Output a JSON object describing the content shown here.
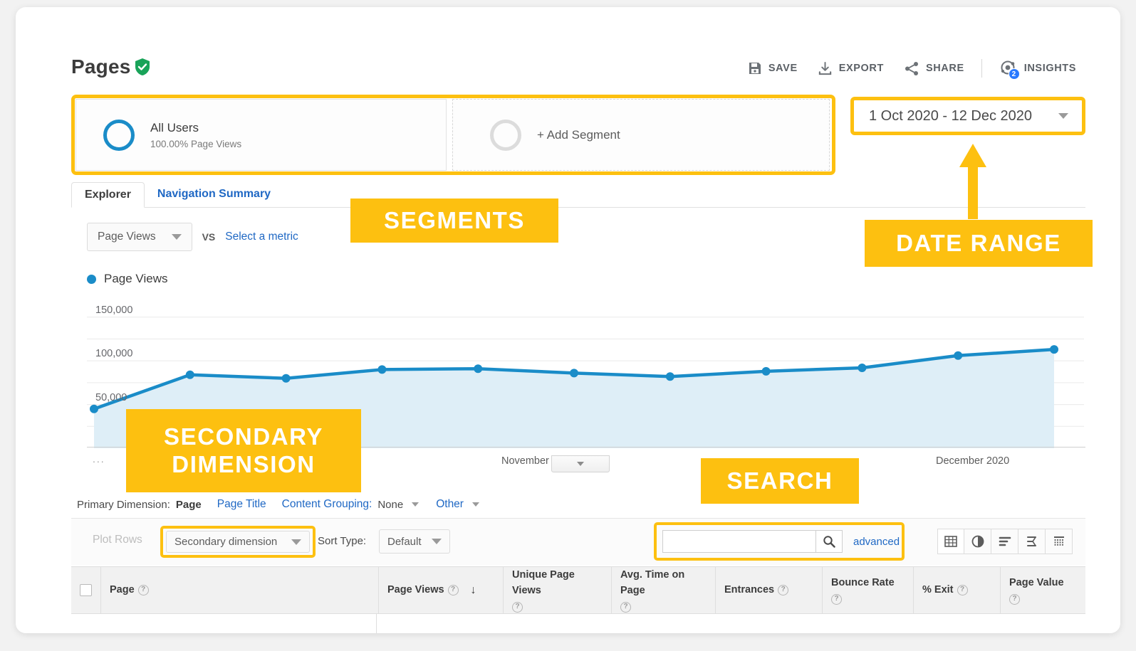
{
  "header": {
    "title": "Pages",
    "verified_icon": "verified-shield-icon",
    "tools": [
      {
        "label": "SAVE",
        "icon": "save-icon"
      },
      {
        "label": "EXPORT",
        "icon": "export-icon"
      },
      {
        "label": "SHARE",
        "icon": "share-icon"
      },
      {
        "label": "INSIGHTS",
        "icon": "insights-icon",
        "badge": "2"
      }
    ]
  },
  "segments": {
    "all_users": {
      "name": "All Users",
      "subtitle": "100.00% Page Views"
    },
    "add_segment_label": "+ Add Segment"
  },
  "date_range": {
    "value": "1 Oct 2020 - 12 Dec 2020",
    "caret_icon": "chevron-down-icon"
  },
  "tabs": [
    {
      "label": "Explorer",
      "active": true
    },
    {
      "label": "Navigation Summary",
      "active": false
    }
  ],
  "metric_selector": {
    "primary_metric": "Page Views",
    "vs_label": "VS",
    "select_metric_label": "Select a metric"
  },
  "chart_data": {
    "type": "area",
    "title": "Page Views",
    "legend": [
      "Page Views"
    ],
    "legend_position": "top-left",
    "grid": true,
    "xlabel": "",
    "ylabel": "",
    "ylim": [
      0,
      175000
    ],
    "yticks": [
      "50,000",
      "100,000",
      "150,000"
    ],
    "ytick_values": [
      50000,
      100000,
      150000
    ],
    "xticks": [
      "November 2020",
      "December 2020"
    ],
    "series": [
      {
        "name": "Page Views",
        "color": "#1a8cc8",
        "fill": "#deeef7",
        "values": [
          45000,
          84000,
          80000,
          90000,
          91000,
          86000,
          82000,
          88000,
          92000,
          106000,
          113000
        ]
      }
    ],
    "ellipsis_label": "..."
  },
  "primary_dimension": {
    "label": "Primary Dimension:",
    "active": "Page",
    "alt": "Page Title",
    "content_grouping_label": "Content Grouping:",
    "content_grouping_value": "None",
    "other_label": "Other"
  },
  "controls": {
    "plot_rows": "Plot Rows",
    "secondary_dimension": "Secondary dimension",
    "sort_type_label": "Sort Type:",
    "sort_type_value": "Default",
    "search_value": "",
    "search_placeholder": "",
    "search_icon": "magnifier-icon",
    "advanced_label": "advanced",
    "view_icons": [
      "table-view-icon",
      "pie-view-icon",
      "performance-view-icon",
      "comparison-view-icon",
      "pivot-view-icon"
    ]
  },
  "table": {
    "columns": [
      {
        "label": "Page",
        "help": "?"
      },
      {
        "label": "Page Views",
        "help": "?",
        "sort": "↓"
      },
      {
        "label": "Unique Page Views",
        "help": "?"
      },
      {
        "label": "Avg. Time on Page",
        "help": "?"
      },
      {
        "label": "Entrances",
        "help": "?"
      },
      {
        "label": "Bounce Rate",
        "help": "?"
      },
      {
        "label": "% Exit",
        "help": "?"
      },
      {
        "label": "Page Value",
        "help": "?"
      }
    ]
  },
  "callouts": [
    {
      "id": "segments",
      "text": "SEGMENTS"
    },
    {
      "id": "date_range",
      "text": "DATE RANGE"
    },
    {
      "id": "secondary_line1",
      "text": "SECONDARY"
    },
    {
      "id": "secondary_line2",
      "text": "DIMENSION"
    },
    {
      "id": "search",
      "text": "SEARCH"
    }
  ],
  "colors": {
    "accent_yellow": "#fdc010",
    "chart_blue": "#1a8cc8",
    "link_blue": "#1f68c4",
    "badge_blue": "#2979ff",
    "verified_green": "#19a359"
  }
}
